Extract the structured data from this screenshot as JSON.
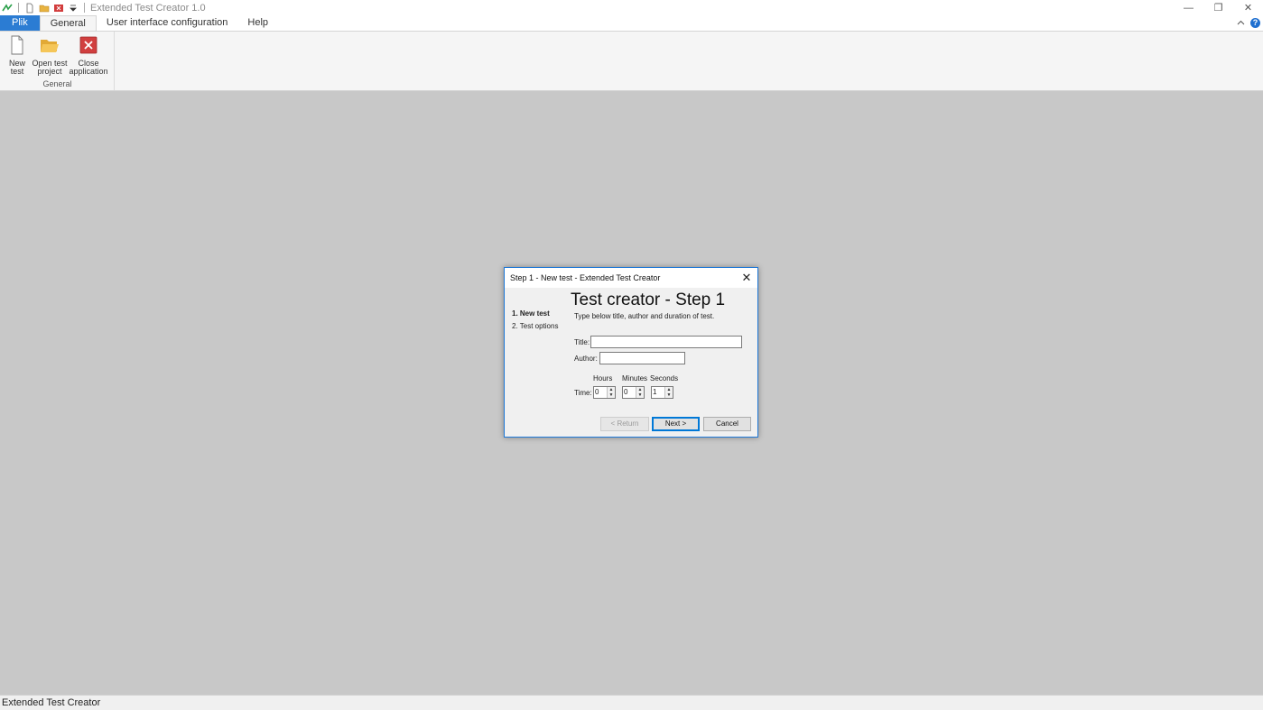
{
  "window": {
    "title": "Extended Test Creator 1.0",
    "controls": {
      "minimize": "—",
      "restore": "❐",
      "close": "✕"
    }
  },
  "ribbon": {
    "tabs": [
      "Plik",
      "General",
      "User interface configuration",
      "Help"
    ],
    "active_tab": "General",
    "group": {
      "label": "General",
      "buttons": [
        {
          "line1": "New",
          "line2": "test",
          "icon": "new-document-icon"
        },
        {
          "line1": "Open test",
          "line2": "project",
          "icon": "open-folder-icon"
        },
        {
          "line1": "Close",
          "line2": "application",
          "icon": "close-app-icon"
        }
      ]
    },
    "help_label": "?",
    "collapse_label": "^"
  },
  "dialog": {
    "title": "Step 1 - New test - Extended Test Creator",
    "steps": [
      "1. New test",
      "2. Test options"
    ],
    "current_step": 1,
    "heading": "Test creator - Step 1",
    "subtitle": "Type below title, author and duration of test.",
    "fields": {
      "title_label": "Title:",
      "title_value": "",
      "author_label": "Author:",
      "author_value": ""
    },
    "time": {
      "label": "Time:",
      "hours_label": "Hours",
      "minutes_label": "Minutes",
      "seconds_label": "Seconds",
      "hours": "0",
      "minutes": "0",
      "seconds": "1"
    },
    "buttons": {
      "return": "< Return",
      "next": "Next >",
      "cancel": "Cancel"
    }
  },
  "statusbar": {
    "text": "Extended Test Creator"
  },
  "colors": {
    "accent": "#2b7cd3",
    "workspace": "#c8c8c8",
    "dialog_border": "#1e78d7"
  }
}
